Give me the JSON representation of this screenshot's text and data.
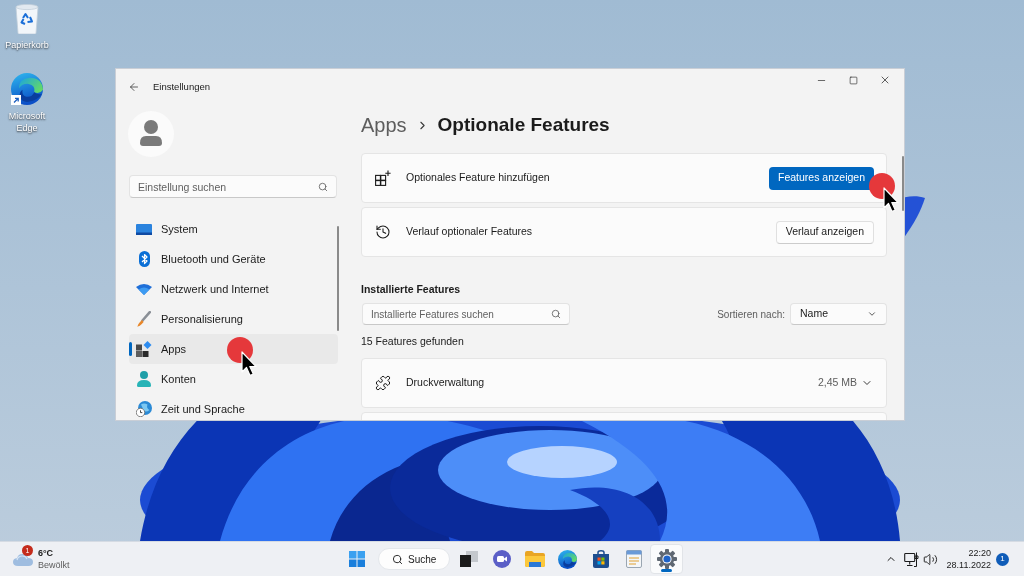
{
  "desktop": {
    "icons": [
      {
        "kind": "recycle-bin",
        "label": "Papierkorb"
      },
      {
        "kind": "edge",
        "label": "Microsoft Edge"
      }
    ]
  },
  "window": {
    "title": "Einstellungen"
  },
  "sidebar": {
    "search": {
      "placeholder": "Einstellung suchen"
    },
    "items": [
      {
        "kind": "system",
        "label": "System",
        "selected": false
      },
      {
        "kind": "bluetooth",
        "label": "Bluetooth und Geräte",
        "selected": false
      },
      {
        "kind": "network",
        "label": "Netzwerk und Internet",
        "selected": false
      },
      {
        "kind": "personalization",
        "label": "Personalisierung",
        "selected": false
      },
      {
        "kind": "apps",
        "label": "Apps",
        "selected": true
      },
      {
        "kind": "accounts",
        "label": "Konten",
        "selected": false
      },
      {
        "kind": "time",
        "label": "Zeit und Sprache",
        "selected": false
      }
    ]
  },
  "content": {
    "breadcrumb": [
      "Apps",
      "Optionale Features"
    ],
    "action_cards": [
      {
        "kind": "add",
        "label": "Optionales Feature hinzufügen",
        "button": {
          "label": "Features anzeigen",
          "primary": true
        }
      },
      {
        "kind": "history",
        "label": "Verlauf optionaler Features",
        "button": {
          "label": "Verlauf anzeigen",
          "primary": false
        }
      }
    ],
    "installed": {
      "heading": "Installierte Features",
      "search": {
        "placeholder": "Installierte Features suchen"
      },
      "sort": {
        "label": "Sortieren nach:",
        "value": "Name"
      },
      "count": "15 Features gefunden",
      "features": [
        {
          "name": "Druckverwaltung",
          "size": "2,45 MB",
          "expanded": false
        }
      ]
    }
  },
  "taskbar": {
    "weather": {
      "temperature": "6°C",
      "condition": "Bewölkt",
      "badge": "1"
    },
    "apps": [
      {
        "kind": "start",
        "active": false
      },
      {
        "kind": "search",
        "label": "Suche",
        "active": false
      },
      {
        "kind": "task-view",
        "active": false
      },
      {
        "kind": "chat",
        "active": false
      },
      {
        "kind": "explorer",
        "active": false
      },
      {
        "kind": "edge",
        "active": false
      },
      {
        "kind": "store",
        "active": false
      },
      {
        "kind": "notepad",
        "active": false
      },
      {
        "kind": "settings",
        "active": true
      }
    ],
    "tray": {
      "time": "22:20",
      "date": "28.11.2022",
      "notification_count": "1"
    }
  }
}
